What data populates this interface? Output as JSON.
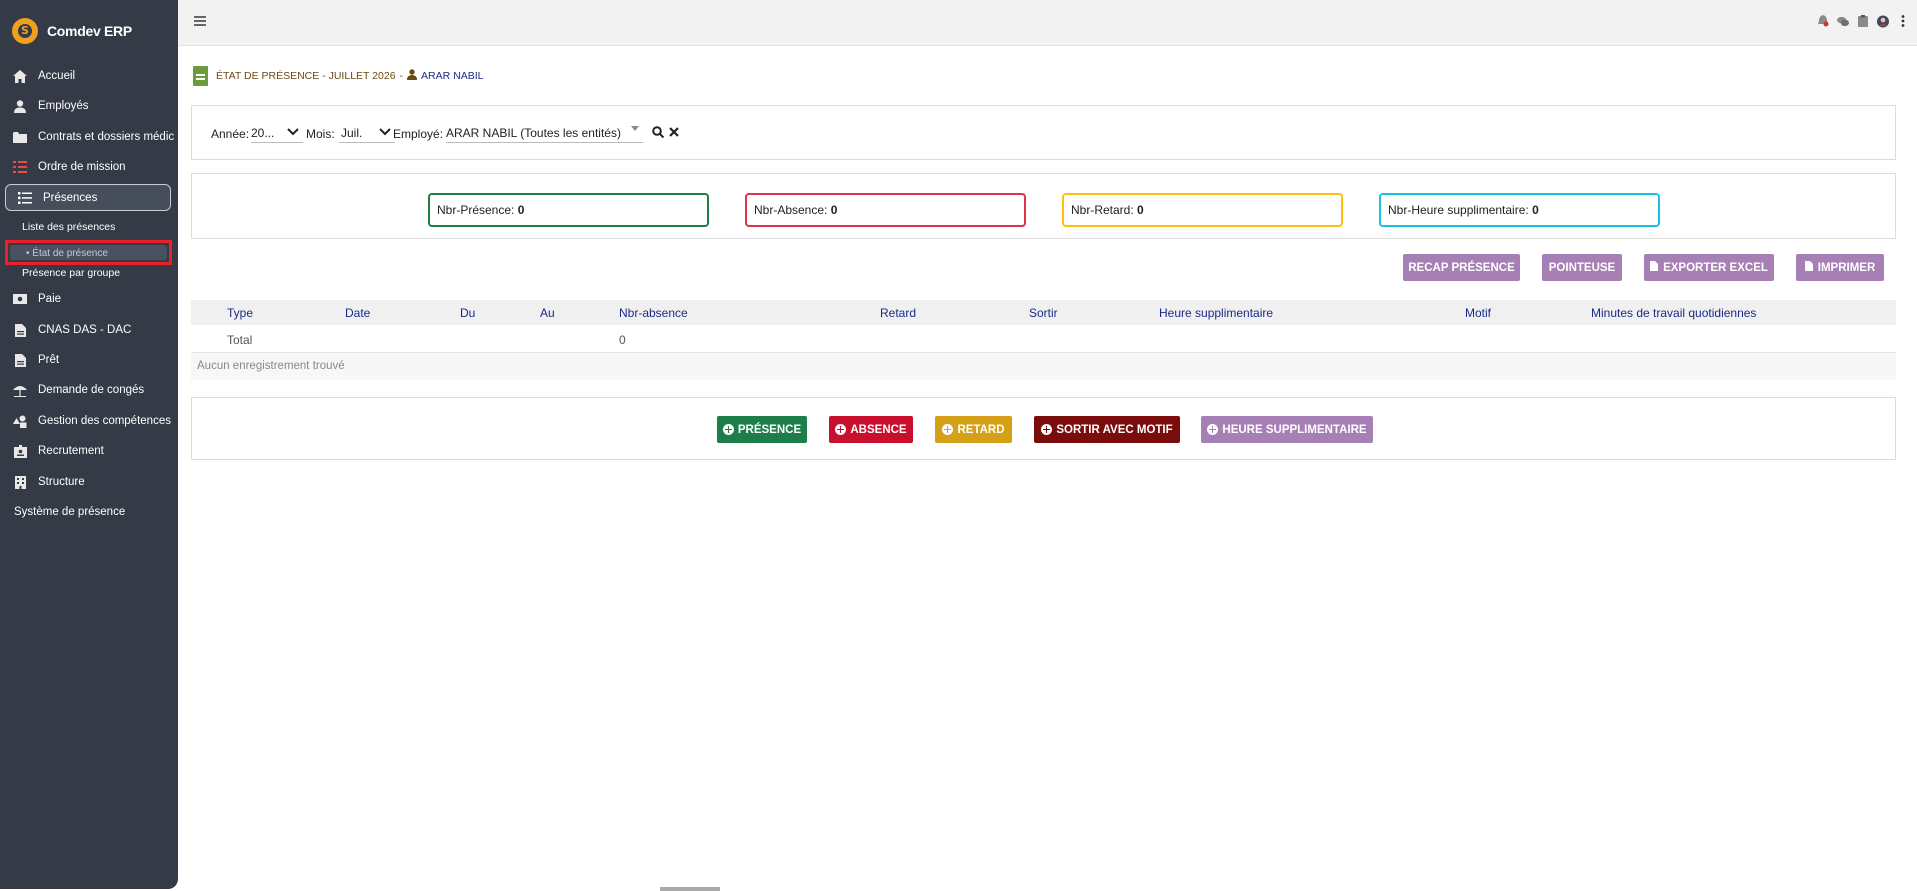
{
  "app": {
    "brand_name": "Comdev ERP",
    "logo_letter": "S"
  },
  "sidebar": {
    "items": [
      {
        "label": "Accueil",
        "icon": "home-icon"
      },
      {
        "label": "Employés",
        "icon": "user-icon"
      },
      {
        "label": "Contrats et dossiers médic",
        "icon": "folder-icon"
      },
      {
        "label": "Ordre de mission",
        "icon": "task-list-icon"
      },
      {
        "label": "Présences",
        "icon": "list-icon"
      },
      {
        "label": "Paie",
        "icon": "money-icon"
      },
      {
        "label": "CNAS DAS - DAC",
        "icon": "document-icon"
      },
      {
        "label": "Prêt",
        "icon": "document-icon"
      },
      {
        "label": "Demande de congés",
        "icon": "beach-icon"
      },
      {
        "label": "Gestion des compétences",
        "icon": "shapes-icon"
      },
      {
        "label": "Recrutement",
        "icon": "id-badge-icon"
      },
      {
        "label": "Structure",
        "icon": "building-icon"
      },
      {
        "label": "Système de présence",
        "icon": ""
      }
    ],
    "sub_items": [
      {
        "label": "Liste des présences"
      },
      {
        "label": "État de présence"
      },
      {
        "label": "Présence par groupe"
      }
    ]
  },
  "breadcrumb": {
    "title": "ÉTAT DE PRÉSENCE - JUILLET 2026",
    "separator": "-",
    "user": "ARAR NABIL"
  },
  "filters": {
    "year_label": "Année:",
    "year_value": "20...",
    "month_label": "Mois:",
    "month_value": "Juil.",
    "employee_label": "Employé:",
    "employee_value": "ARAR NABIL (Toutes les entités)"
  },
  "stats": [
    {
      "label": "Nbr-Présence:",
      "value": "0",
      "color": "#1e7e4a"
    },
    {
      "label": "Nbr-Absence:",
      "value": "0",
      "color": "#dc3545"
    },
    {
      "label": "Nbr-Retard:",
      "value": "0",
      "color": "#ffc107"
    },
    {
      "label": "Nbr-Heure supplimentaire:",
      "value": "0",
      "color": "#17c1e8"
    }
  ],
  "actions": {
    "recap": "RECAP PRÉSENCE",
    "pointeuse": "POINTEUSE",
    "export": "EXPORTER EXCEL",
    "print": "IMPRIMER"
  },
  "table": {
    "columns": [
      "Type",
      "Date",
      "Du",
      "Au",
      "Nbr-absence",
      "Retard",
      "Sortir",
      "Heure supplimentaire",
      "Motif",
      "Minutes de travail quotidiennes"
    ],
    "total_row": {
      "type": "Total",
      "nbr_absence": "0"
    },
    "empty_message": "Aucun enregistrement trouvé"
  },
  "add_buttons": {
    "presence": {
      "label": "PRÉSENCE",
      "color": "#1e7e4a"
    },
    "absence": {
      "label": "ABSENCE",
      "color": "#c8102e"
    },
    "retard": {
      "label": "RETARD",
      "color": "#d4a017"
    },
    "sortir": {
      "label": "SORTIR AVEC MOTIF",
      "color": "#7a0c0c"
    },
    "heure": {
      "label": "HEURE SUPPLIMENTAIRE",
      "color": "#a67fb4"
    }
  }
}
